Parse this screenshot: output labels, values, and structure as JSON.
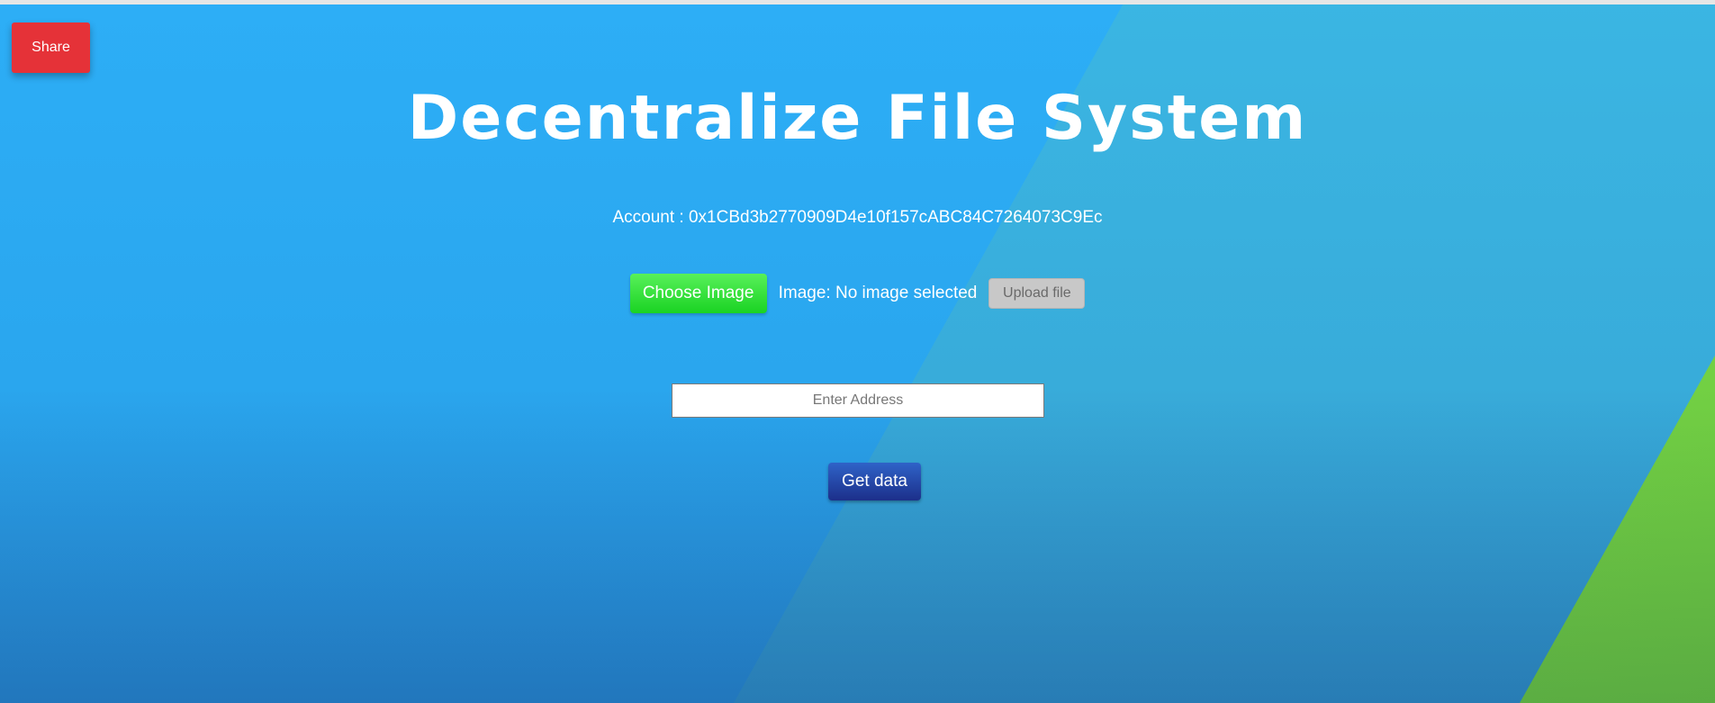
{
  "header": {
    "share_label": "Share",
    "title": "Decentralize File System"
  },
  "account": {
    "text": "Account : 0x1CBd3b2770909D4e10f157cABC84C7264073C9Ec"
  },
  "upload": {
    "choose_label": "Choose Image",
    "status_text": "Image: No image selected",
    "upload_label": "Upload file"
  },
  "address": {
    "placeholder": "Enter Address",
    "value": ""
  },
  "actions": {
    "get_data_label": "Get data"
  },
  "colors": {
    "share_button": "#e53238",
    "choose_button": "#1ad323",
    "get_data_button": "#1c2f8a",
    "background": "#2aa9f2",
    "accent_green": "#6cc93c"
  }
}
